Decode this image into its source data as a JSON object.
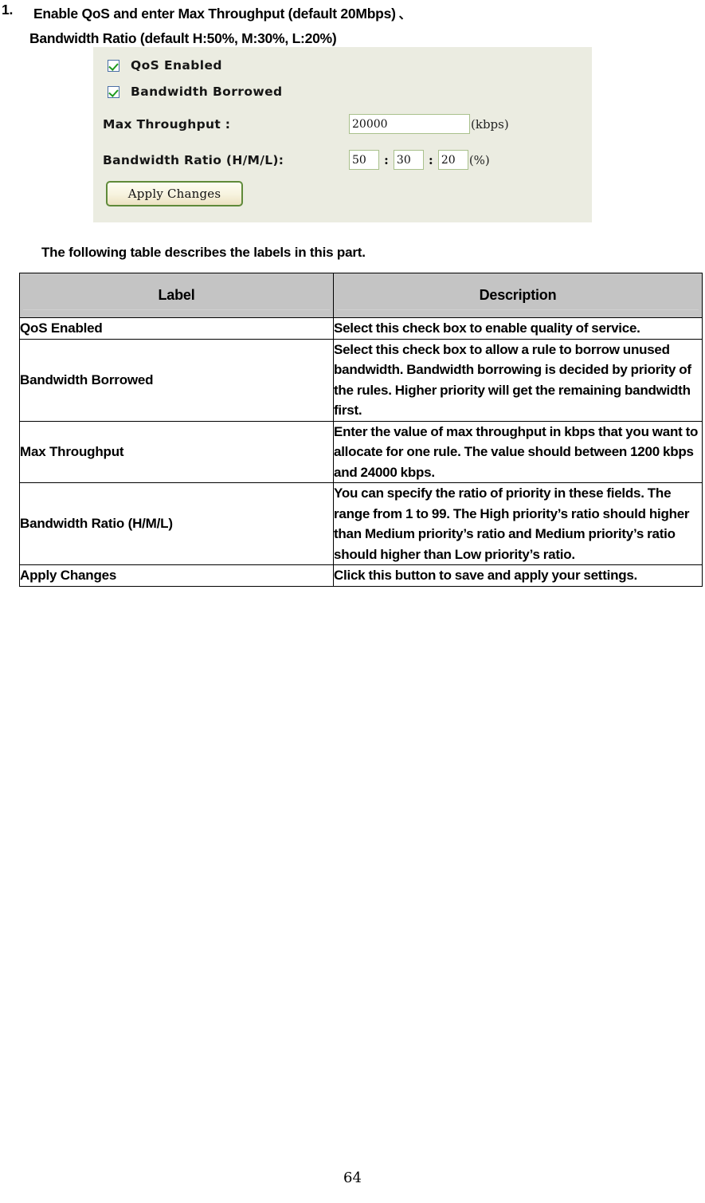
{
  "instruction": {
    "number": "1.",
    "line1": "Enable QoS and enter Max Throughput (default 20Mbps)",
    "trailing_mark": "、",
    "line2": "Bandwidth Ratio (default H:50%, M:30%, L:20%)"
  },
  "screenshot": {
    "background_color": "#ebece1",
    "qos_enabled": {
      "label": "QoS Enabled",
      "checked": true
    },
    "bandwidth_borrowed": {
      "label": "Bandwidth Borrowed",
      "checked": true
    },
    "max_throughput": {
      "label": "Max Throughput :",
      "value": "20000",
      "unit": "(kbps)"
    },
    "bandwidth_ratio": {
      "label": "Bandwidth Ratio (H/M/L):",
      "high": "50",
      "medium": "30",
      "low": "20",
      "separator": ":",
      "unit": "(%)"
    },
    "apply_button": {
      "label": "Apply Changes",
      "border_color": "#5f8a3a"
    }
  },
  "caption": "The following table describes the labels in this part.",
  "table": {
    "header_background": "#c4c4c4",
    "columns": [
      "Label",
      "Description"
    ],
    "rows": [
      {
        "label": "QoS Enabled",
        "description": "Select this check box to enable quality of service."
      },
      {
        "label": "Bandwidth Borrowed",
        "description": "Select this check box to allow a rule to borrow unused bandwidth. Bandwidth borrowing is decided by priority of the rules. Higher priority will get the remaining bandwidth first."
      },
      {
        "label": "Max Throughput",
        "description": "Enter the value of max throughput in kbps that you want to allocate for one rule. The value should between 1200 kbps and 24000 kbps."
      },
      {
        "label": "Bandwidth Ratio (H/M/L)",
        "description": "You can specify the ratio of priority in these fields. The range from 1 to 99. The High priority’s ratio should higher than Medium priority’s ratio and Medium priority’s ratio should higher than Low priority’s ratio."
      },
      {
        "label": "Apply Changes",
        "description": "Click this button to save and apply your settings."
      }
    ]
  },
  "page_number": "64"
}
